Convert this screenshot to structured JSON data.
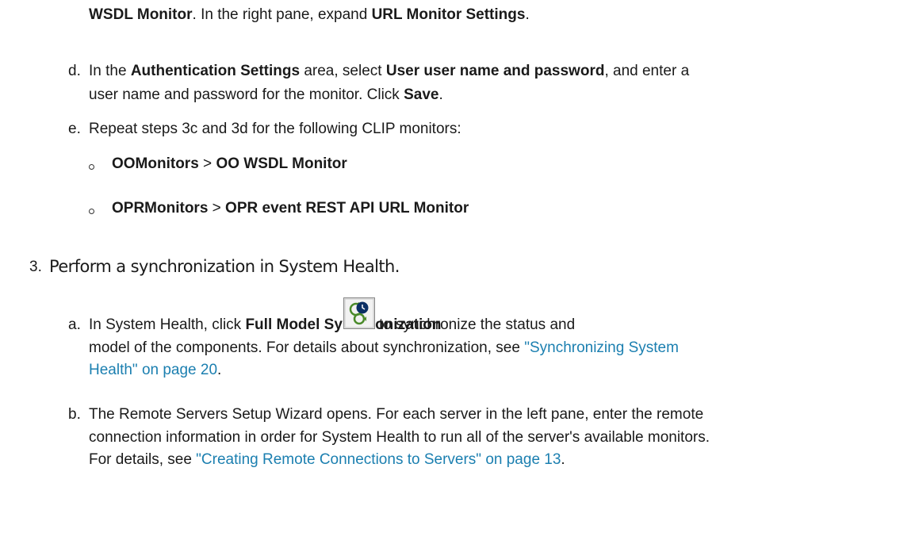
{
  "line0": {
    "b1": "WSDL Monitor",
    "t1": ". In the right pane, expand ",
    "b2": "URL Monitor Settings",
    "t2": "."
  },
  "step_d": {
    "marker": "d.",
    "t1": "In the ",
    "b1": "Authentication Settings",
    "t2": " area, select ",
    "b2": "User user name and password",
    "t3": ", and enter a",
    "line2_t1": "user name and password for the monitor. Click ",
    "line2_b1": "Save",
    "line2_t2": "."
  },
  "step_e": {
    "marker": "e.",
    "text": "Repeat steps 3c and 3d for the following CLIP monitors:"
  },
  "bullets": [
    {
      "b1": "OOMonitors",
      "sep": " > ",
      "b2": "OO WSDL Monitor"
    },
    {
      "b1": "OPRMonitors",
      "sep": " > ",
      "b2": "OPR event REST API URL Monitor"
    }
  ],
  "step3": {
    "marker": "3.",
    "heading": "Perform a synchronization in System Health."
  },
  "step_a": {
    "marker": "a.",
    "t1": "In System Health, click ",
    "b1": "Full Model Synchronization",
    "t2": " to synchronize the status and",
    "line2": "model of the components. For details about synchronization, see ",
    "link1": "\"Synchronizing System",
    "link2": "Health\" on page 20",
    "line3_tail": ".",
    "icon": "full-model-sync-icon"
  },
  "step_b": {
    "marker": "b.",
    "line1": "The Remote Servers Setup Wizard opens. For each server in the left pane, enter the remote",
    "line2": "connection information in order for System Health to run all of the server's available monitors.",
    "line3_pre": "For details, see ",
    "link": "\"Creating Remote Connections to Servers\" on page 13",
    "line3_tail": "."
  },
  "colors": {
    "text": "#1a1a1a",
    "link": "#1b7fb0"
  }
}
